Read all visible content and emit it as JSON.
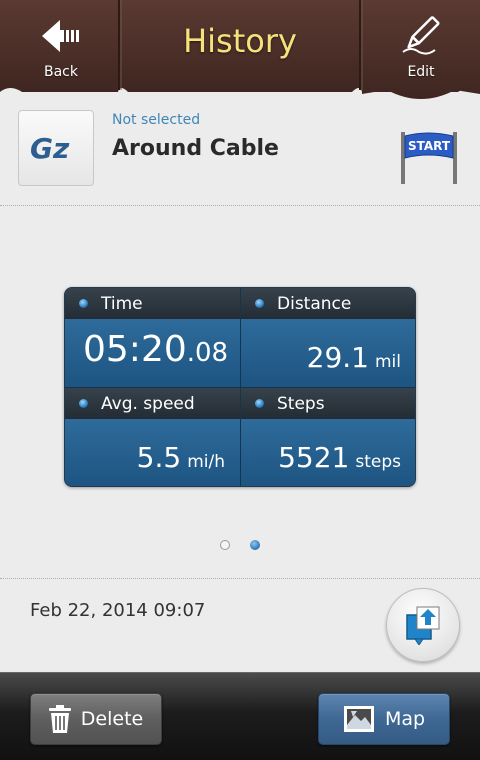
{
  "header": {
    "title": "History",
    "back_label": "Back",
    "edit_label": "Edit"
  },
  "route": {
    "status": "Not selected",
    "name": "Around Cable",
    "flag_text": "START",
    "logo_text": "Gz"
  },
  "stats": {
    "time": {
      "label": "Time",
      "main": "05:20",
      "fraction": ".08"
    },
    "distance": {
      "label": "Distance",
      "value": "29.1",
      "unit": "mil"
    },
    "avg_speed": {
      "label": "Avg. speed",
      "value": "5.5",
      "unit": "mi/h"
    },
    "steps": {
      "label": "Steps",
      "value": "5521",
      "unit": "steps"
    }
  },
  "pager": {
    "count": 2,
    "active_index": 1
  },
  "date": "Feb 22, 2014 09:07",
  "bottom": {
    "delete_label": "Delete",
    "map_label": "Map"
  },
  "colors": {
    "header_brown": "#4a2f28",
    "title_yellow": "#f6e27a",
    "accent_blue": "#3f86b8",
    "panel_blue": "#1f5986"
  },
  "icons": {
    "back": "back-arrow-icon",
    "edit": "pencil-icon",
    "start": "start-flag-icon",
    "share": "share-icon",
    "delete": "trash-icon",
    "map": "map-icon"
  }
}
